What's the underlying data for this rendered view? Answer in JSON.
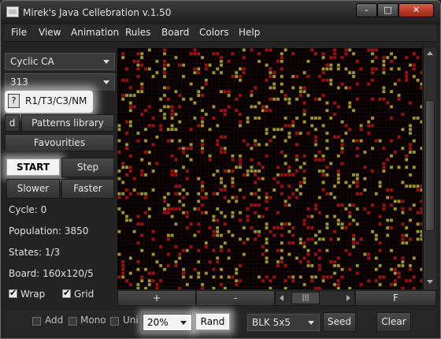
{
  "window": {
    "title": "Mirek's Java Cellebration v.1.50"
  },
  "menu": [
    "File",
    "View",
    "Animation",
    "Rules",
    "Board",
    "Colors",
    "Help"
  ],
  "left": {
    "family_select": "Cyclic CA",
    "rule_number_select": "313",
    "help_label": "?",
    "rule_text": "R1/T3/C3/NM",
    "d_label": "d",
    "patterns_label": "Patterns library",
    "favourites_label": "Favourities",
    "start_label": "START",
    "step_label": "Step",
    "slower_label": "Slower",
    "faster_label": "Faster",
    "cycle": "Cycle: 0",
    "population": "Population: 3850",
    "states": "States: 1/3",
    "board": "Board: 160x120/5",
    "wrap_label": "Wrap",
    "grid_label": "Grid"
  },
  "board_nav": {
    "zoom_in": "+",
    "zoom_out": "-",
    "scroll_thumb": "|||",
    "fit": "F"
  },
  "bottom": {
    "add_label": "Add",
    "mono_label": "Mono",
    "uni_label": "Uni",
    "density_select": "20%",
    "rand_label": "Rand",
    "pattern_select": "BLK 5x5",
    "seed_label": "Seed",
    "clear_label": "Clear"
  },
  "colors": {
    "state1": "#9a9a2a",
    "state2": "#a01010",
    "grid": "#2a0505",
    "background": "#000000"
  }
}
